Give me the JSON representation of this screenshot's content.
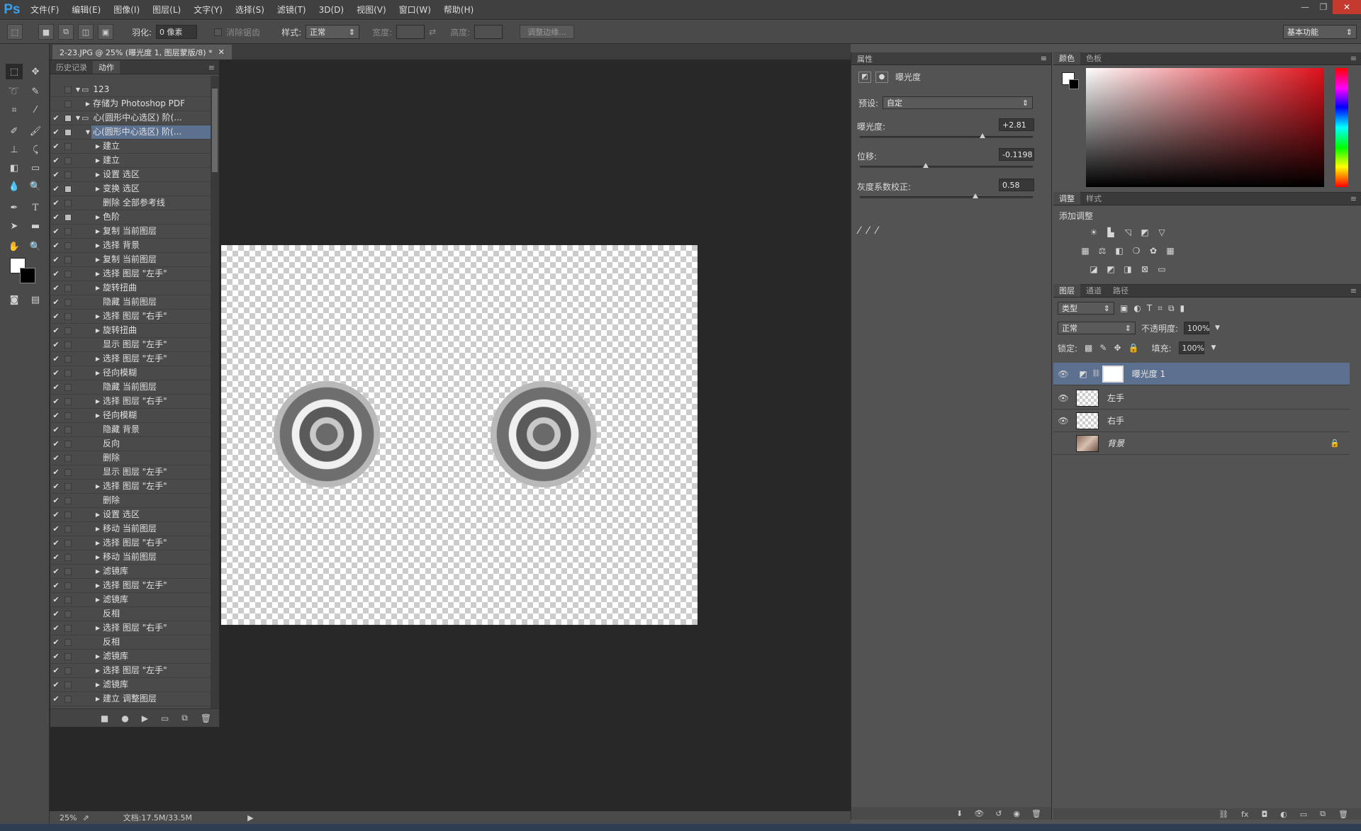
{
  "app": {
    "logo": "Ps"
  },
  "menu": [
    "文件(F)",
    "编辑(E)",
    "图像(I)",
    "图层(L)",
    "文字(Y)",
    "选择(S)",
    "滤镜(T)",
    "3D(D)",
    "视图(V)",
    "窗口(W)",
    "帮助(H)"
  ],
  "options": {
    "feather_label": "羽化:",
    "feather_value": "0 像素",
    "antialias_label": "消除锯齿",
    "style_label": "样式:",
    "style_value": "正常",
    "width_label": "宽度:",
    "height_label": "高度:",
    "refine_edge": "调整边缘...",
    "workspace": "基本功能"
  },
  "document": {
    "tab_title": "2-23.JPG @ 25% (曝光度 1, 图层蒙版/8) *",
    "zoom": "25%",
    "doc_size": "文档:17.5M/33.5M"
  },
  "actions_panel": {
    "tab_history": "历史记录",
    "tab_actions": "动作",
    "rows": [
      {
        "check": "",
        "dlg": false,
        "tri": "▼",
        "indent": 1,
        "label": "123",
        "folder": true
      },
      {
        "check": "",
        "dlg": false,
        "tri": "▶",
        "indent": 2,
        "label": "存储为 Photoshop PDF"
      },
      {
        "check": "✔",
        "dlg": true,
        "tri": "▼",
        "indent": 1,
        "label": "心(圆形中心选区) 阶(...",
        "folder": true
      },
      {
        "check": "✔",
        "dlg": true,
        "tri": "▼",
        "indent": 2,
        "label": "心(圆形中心选区) 阶(...",
        "selected": true
      },
      {
        "check": "✔",
        "dlg": false,
        "tri": "▶",
        "indent": 3,
        "label": "建立"
      },
      {
        "check": "✔",
        "dlg": false,
        "tri": "▶",
        "indent": 3,
        "label": "建立"
      },
      {
        "check": "✔",
        "dlg": false,
        "tri": "▶",
        "indent": 3,
        "label": "设置 选区"
      },
      {
        "check": "✔",
        "dlg": true,
        "tri": "▶",
        "indent": 3,
        "label": "变换 选区"
      },
      {
        "check": "✔",
        "dlg": false,
        "tri": "",
        "indent": 3,
        "label": "删除 全部参考线"
      },
      {
        "check": "✔",
        "dlg": true,
        "tri": "▶",
        "indent": 3,
        "label": "色阶"
      },
      {
        "check": "✔",
        "dlg": false,
        "tri": "▶",
        "indent": 3,
        "label": "复制 当前图层"
      },
      {
        "check": "✔",
        "dlg": false,
        "tri": "▶",
        "indent": 3,
        "label": "选择 背景"
      },
      {
        "check": "✔",
        "dlg": false,
        "tri": "▶",
        "indent": 3,
        "label": "复制 当前图层"
      },
      {
        "check": "✔",
        "dlg": false,
        "tri": "▶",
        "indent": 3,
        "label": "选择 图层 \"左手\""
      },
      {
        "check": "✔",
        "dlg": false,
        "tri": "▶",
        "indent": 3,
        "label": "旋转扭曲"
      },
      {
        "check": "✔",
        "dlg": false,
        "tri": "",
        "indent": 3,
        "label": "隐藏 当前图层"
      },
      {
        "check": "✔",
        "dlg": false,
        "tri": "▶",
        "indent": 3,
        "label": "选择 图层 \"右手\""
      },
      {
        "check": "✔",
        "dlg": false,
        "tri": "▶",
        "indent": 3,
        "label": "旋转扭曲"
      },
      {
        "check": "✔",
        "dlg": false,
        "tri": "",
        "indent": 3,
        "label": "显示 图层 \"左手\""
      },
      {
        "check": "✔",
        "dlg": false,
        "tri": "▶",
        "indent": 3,
        "label": "选择 图层 \"左手\""
      },
      {
        "check": "✔",
        "dlg": false,
        "tri": "▶",
        "indent": 3,
        "label": "径向模糊"
      },
      {
        "check": "✔",
        "dlg": false,
        "tri": "",
        "indent": 3,
        "label": "隐藏 当前图层"
      },
      {
        "check": "✔",
        "dlg": false,
        "tri": "▶",
        "indent": 3,
        "label": "选择 图层 \"右手\""
      },
      {
        "check": "✔",
        "dlg": false,
        "tri": "▶",
        "indent": 3,
        "label": "径向模糊"
      },
      {
        "check": "✔",
        "dlg": false,
        "tri": "",
        "indent": 3,
        "label": "隐藏 背景"
      },
      {
        "check": "✔",
        "dlg": false,
        "tri": "",
        "indent": 3,
        "label": "反向"
      },
      {
        "check": "✔",
        "dlg": false,
        "tri": "",
        "indent": 3,
        "label": "删除"
      },
      {
        "check": "✔",
        "dlg": false,
        "tri": "",
        "indent": 3,
        "label": "显示 图层 \"左手\""
      },
      {
        "check": "✔",
        "dlg": false,
        "tri": "▶",
        "indent": 3,
        "label": "选择 图层 \"左手\""
      },
      {
        "check": "✔",
        "dlg": false,
        "tri": "",
        "indent": 3,
        "label": "删除"
      },
      {
        "check": "✔",
        "dlg": false,
        "tri": "▶",
        "indent": 3,
        "label": "设置 选区"
      },
      {
        "check": "✔",
        "dlg": false,
        "tri": "▶",
        "indent": 3,
        "label": "移动 当前图层"
      },
      {
        "check": "✔",
        "dlg": false,
        "tri": "▶",
        "indent": 3,
        "label": "选择 图层 \"右手\""
      },
      {
        "check": "✔",
        "dlg": false,
        "tri": "▶",
        "indent": 3,
        "label": "移动 当前图层"
      },
      {
        "check": "✔",
        "dlg": false,
        "tri": "▶",
        "indent": 3,
        "label": "滤镜库"
      },
      {
        "check": "✔",
        "dlg": false,
        "tri": "▶",
        "indent": 3,
        "label": "选择 图层 \"左手\""
      },
      {
        "check": "✔",
        "dlg": false,
        "tri": "▶",
        "indent": 3,
        "label": "滤镜库"
      },
      {
        "check": "✔",
        "dlg": false,
        "tri": "",
        "indent": 3,
        "label": "反相"
      },
      {
        "check": "✔",
        "dlg": false,
        "tri": "▶",
        "indent": 3,
        "label": "选择 图层 \"右手\""
      },
      {
        "check": "✔",
        "dlg": false,
        "tri": "",
        "indent": 3,
        "label": "反相"
      },
      {
        "check": "✔",
        "dlg": false,
        "tri": "▶",
        "indent": 3,
        "label": "滤镜库"
      },
      {
        "check": "✔",
        "dlg": false,
        "tri": "▶",
        "indent": 3,
        "label": "选择 图层 \"左手\""
      },
      {
        "check": "✔",
        "dlg": false,
        "tri": "▶",
        "indent": 3,
        "label": "滤镜库"
      },
      {
        "check": "✔",
        "dlg": false,
        "tri": "▶",
        "indent": 3,
        "label": "建立 调整图层"
      }
    ]
  },
  "properties": {
    "tab": "属性",
    "title": "曝光度",
    "preset_label": "预设:",
    "preset_value": "自定",
    "exposure_label": "曝光度:",
    "exposure_value": "+2.81",
    "exposure_pos": 0.71,
    "offset_label": "位移:",
    "offset_value": "-0.1198",
    "offset_pos": 0.38,
    "gamma_label": "灰度系数校正:",
    "gamma_value": "0.58",
    "gamma_pos": 0.67
  },
  "color_panel": {
    "tab_color": "颜色",
    "tab_swatches": "色板"
  },
  "adjustments": {
    "tab_adj": "调整",
    "tab_style": "样式",
    "add_label": "添加调整"
  },
  "layers_panel": {
    "tab_layers": "图层",
    "tab_channels": "通道",
    "tab_paths": "路径",
    "filter_kind": "类型",
    "blend_mode": "正常",
    "opacity_label": "不透明度:",
    "opacity_value": "100%",
    "lock_label": "锁定:",
    "fill_label": "填充:",
    "fill_value": "100%",
    "layers": [
      {
        "name": "曝光度 1",
        "visible": true,
        "selected": true,
        "adjustment": true
      },
      {
        "name": "左手",
        "visible": true
      },
      {
        "name": "右手",
        "visible": true
      },
      {
        "name": "背景",
        "visible": false,
        "italic": true,
        "locked": true
      }
    ]
  },
  "colors": {
    "accent": "#5c708f",
    "ps_blue": "#3aa0f0"
  }
}
